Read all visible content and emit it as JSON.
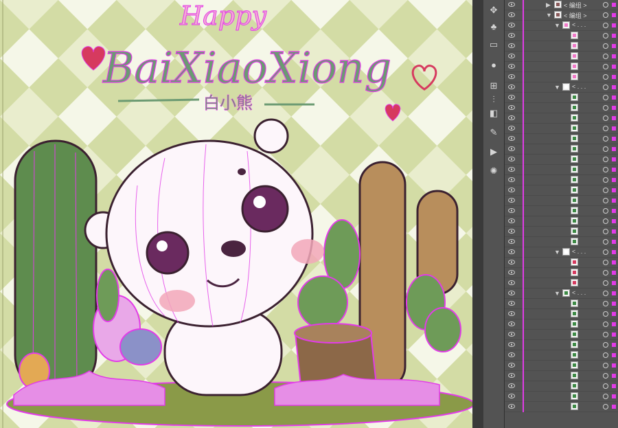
{
  "artwork": {
    "title_happy": "Happy",
    "title_main": "BaiXiaoXiong",
    "subtitle": "白小熊",
    "colors": {
      "check_light": "#e9edcd",
      "check_dark": "#d3dca5",
      "path_magenta": "#e23be8",
      "cactus_green": "#5e8c4e",
      "cactus_brown": "#b88e5c",
      "bear_white": "#fdf6fb",
      "ground": "#8a9a48",
      "heart_red": "#d63a5f"
    }
  },
  "toolbar": {
    "tools": [
      "puppet-warp-icon",
      "symbol-icon",
      "swatch-icon",
      "3d-sphere-icon",
      "align-icon",
      "distribute-icon",
      "pathfinder-icon",
      "brush-icon",
      "play-icon",
      "sun-icon"
    ]
  },
  "layers_panel": {
    "rows": [
      {
        "indent": 0,
        "twirl": "▶",
        "thumb": "photo",
        "name": "< 编组 >"
      },
      {
        "indent": 0,
        "twirl": "▼",
        "thumb": "photo",
        "name": "< 编组 >"
      },
      {
        "indent": 1,
        "twirl": "▼",
        "thumb": "pink",
        "name": "< . . ."
      },
      {
        "indent": 2,
        "twirl": "",
        "thumb": "pink",
        "name": ""
      },
      {
        "indent": 2,
        "twirl": "",
        "thumb": "pink",
        "name": ""
      },
      {
        "indent": 2,
        "twirl": "",
        "thumb": "pink",
        "name": ""
      },
      {
        "indent": 2,
        "twirl": "",
        "thumb": "pink",
        "name": ""
      },
      {
        "indent": 2,
        "twirl": "",
        "thumb": "pink",
        "name": ""
      },
      {
        "indent": 1,
        "twirl": "▼",
        "thumb": "blank",
        "name": "< . . ."
      },
      {
        "indent": 2,
        "twirl": "",
        "thumb": "green",
        "name": ""
      },
      {
        "indent": 2,
        "twirl": "",
        "thumb": "green",
        "name": ""
      },
      {
        "indent": 2,
        "twirl": "",
        "thumb": "green",
        "name": ""
      },
      {
        "indent": 2,
        "twirl": "",
        "thumb": "green",
        "name": ""
      },
      {
        "indent": 2,
        "twirl": "",
        "thumb": "green",
        "name": ""
      },
      {
        "indent": 2,
        "twirl": "",
        "thumb": "green",
        "name": ""
      },
      {
        "indent": 2,
        "twirl": "",
        "thumb": "green",
        "name": ""
      },
      {
        "indent": 2,
        "twirl": "",
        "thumb": "green",
        "name": ""
      },
      {
        "indent": 2,
        "twirl": "",
        "thumb": "green",
        "name": ""
      },
      {
        "indent": 2,
        "twirl": "",
        "thumb": "green",
        "name": ""
      },
      {
        "indent": 2,
        "twirl": "",
        "thumb": "green",
        "name": ""
      },
      {
        "indent": 2,
        "twirl": "",
        "thumb": "green",
        "name": ""
      },
      {
        "indent": 2,
        "twirl": "",
        "thumb": "green",
        "name": ""
      },
      {
        "indent": 2,
        "twirl": "",
        "thumb": "green",
        "name": ""
      },
      {
        "indent": 2,
        "twirl": "",
        "thumb": "green",
        "name": ""
      },
      {
        "indent": 1,
        "twirl": "▼",
        "thumb": "blank",
        "name": "< . . ."
      },
      {
        "indent": 2,
        "twirl": "",
        "thumb": "red",
        "name": ""
      },
      {
        "indent": 2,
        "twirl": "",
        "thumb": "red",
        "name": ""
      },
      {
        "indent": 2,
        "twirl": "",
        "thumb": "red",
        "name": ""
      },
      {
        "indent": 1,
        "twirl": "▼",
        "thumb": "green",
        "name": "< . . ."
      },
      {
        "indent": 2,
        "twirl": "",
        "thumb": "green",
        "name": ""
      },
      {
        "indent": 2,
        "twirl": "",
        "thumb": "green",
        "name": ""
      },
      {
        "indent": 2,
        "twirl": "",
        "thumb": "green",
        "name": ""
      },
      {
        "indent": 2,
        "twirl": "",
        "thumb": "green",
        "name": ""
      },
      {
        "indent": 2,
        "twirl": "",
        "thumb": "green",
        "name": ""
      },
      {
        "indent": 2,
        "twirl": "",
        "thumb": "green",
        "name": ""
      },
      {
        "indent": 2,
        "twirl": "",
        "thumb": "green",
        "name": ""
      },
      {
        "indent": 2,
        "twirl": "",
        "thumb": "green",
        "name": ""
      },
      {
        "indent": 2,
        "twirl": "",
        "thumb": "green",
        "name": ""
      },
      {
        "indent": 2,
        "twirl": "",
        "thumb": "green",
        "name": ""
      },
      {
        "indent": 2,
        "twirl": "",
        "thumb": "green",
        "name": ""
      }
    ]
  }
}
